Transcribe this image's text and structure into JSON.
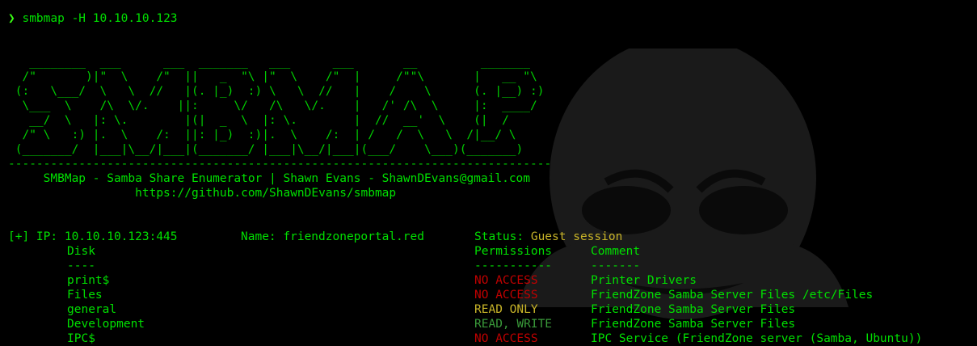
{
  "prompt": {
    "symbol": "❯",
    "command": "smbmap -H 10.10.10.123"
  },
  "banner": {
    "ascii_art": "   ________  ___      ___  _______   ___      ___       __         _______\n  /\"       )|\"  \\    /\"  ||   _  \"\\ |\"  \\    /\"  |     /\"\"\\       |   __ \"\\\n (:   \\___/  \\   \\  //   |(. |_)  :) \\   \\  //   |    /    \\      (. |__) :)\n  \\___  \\    /\\  \\/.    ||:     \\/   /\\   \\/.    |   /' /\\  \\     |:  ____/\n   __/  \\   |: \\.        |(|  _  \\  |: \\.        |  //  __'  \\    (|  /\n  /\" \\   :) |.  \\    /:  ||: |_)  :)|.  \\    /:  | /   /  \\   \\  /|__/ \\\n (_______/  |___|\\__/|___|(_______/ |___|\\__/|___|(___/    \\___)(_______)\n-----------------------------------------------------------------------------",
    "title": "SMBMap - Samba Share Enumerator | Shawn Evans - ShawnDEvans@gmail.com",
    "url": "https://github.com/ShawnDEvans/smbmap"
  },
  "host": {
    "ip_line": "[+] IP: 10.10.10.123:445",
    "name_line": "Name: friendzoneportal.red",
    "status_label": "Status: ",
    "status_value": "Guest session"
  },
  "table": {
    "headers": {
      "disk": "Disk",
      "permissions": "Permissions",
      "comment": "Comment"
    },
    "separators": {
      "disk": "----",
      "permissions": "-----------",
      "comment": "-------"
    },
    "rows": [
      {
        "disk": "print$",
        "permissions": "NO ACCESS",
        "perm_class": "no",
        "comment": "Printer Drivers"
      },
      {
        "disk": "Files",
        "permissions": "NO ACCESS",
        "perm_class": "no",
        "comment": "FriendZone Samba Server Files /etc/Files"
      },
      {
        "disk": "general",
        "permissions": "READ ONLY",
        "perm_class": "ro",
        "comment": "FriendZone Samba Server Files"
      },
      {
        "disk": "Development",
        "permissions": "READ, WRITE",
        "perm_class": "rw",
        "comment": "FriendZone Samba Server Files"
      },
      {
        "disk": "IPC$",
        "permissions": "NO ACCESS",
        "perm_class": "no",
        "comment": "IPC Service (FriendZone server (Samba, Ubuntu))"
      }
    ]
  },
  "colors": {
    "background": "#000000",
    "text_green": "#00e000",
    "no_access": "#c00000",
    "read_only": "#c8b428",
    "read_write": "#3a9a3a",
    "guest_session": "#c8b428"
  },
  "background_art_icon": "guy-fawkes-mask-icon"
}
